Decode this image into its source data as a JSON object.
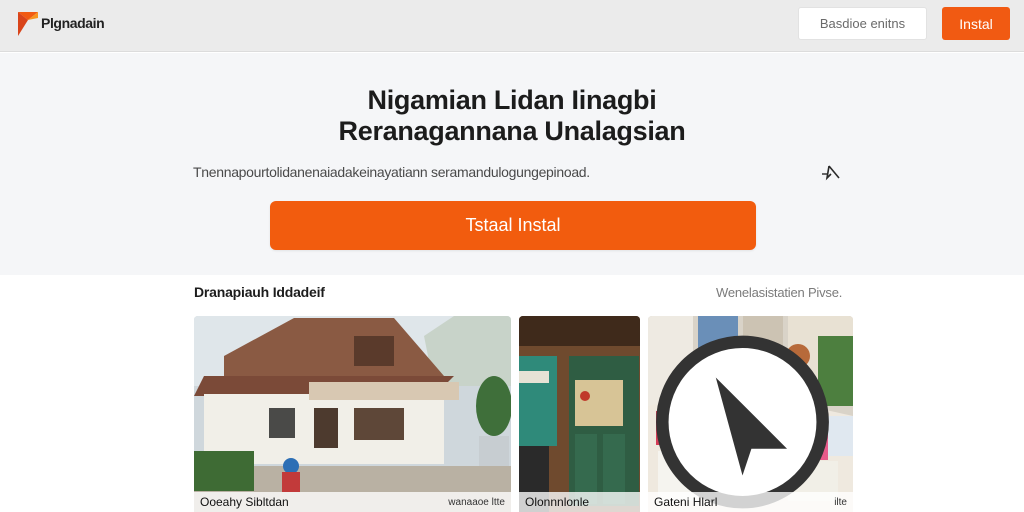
{
  "header": {
    "brand_name": "Plgnadain",
    "search_label": "Basdioe enitns",
    "install_label": "Instal"
  },
  "hero": {
    "title_line1": "Nigamian Lidan Iinagbi",
    "title_line2": "Reranagannana Unalagsian",
    "description": "Tnennapourtolidanenaiadakeinayatiann seramandulogungepinoad.",
    "install_label": "Tstaal Instal"
  },
  "section": {
    "title": "Dranapiauh Iddadeif",
    "link_label": "Wenelasistatien Pivse."
  },
  "cards": [
    {
      "caption": "Ooeahy Sibltdan",
      "meta": "wanaaoe ltte"
    },
    {
      "caption": "Olonnnlonle",
      "meta": ""
    },
    {
      "caption": "Gateni Hlarl",
      "meta": "ilte"
    }
  ],
  "colors": {
    "accent": "#f25c0e",
    "header_bg": "#ebebeb",
    "hero_bg": "#f5f6f8"
  }
}
